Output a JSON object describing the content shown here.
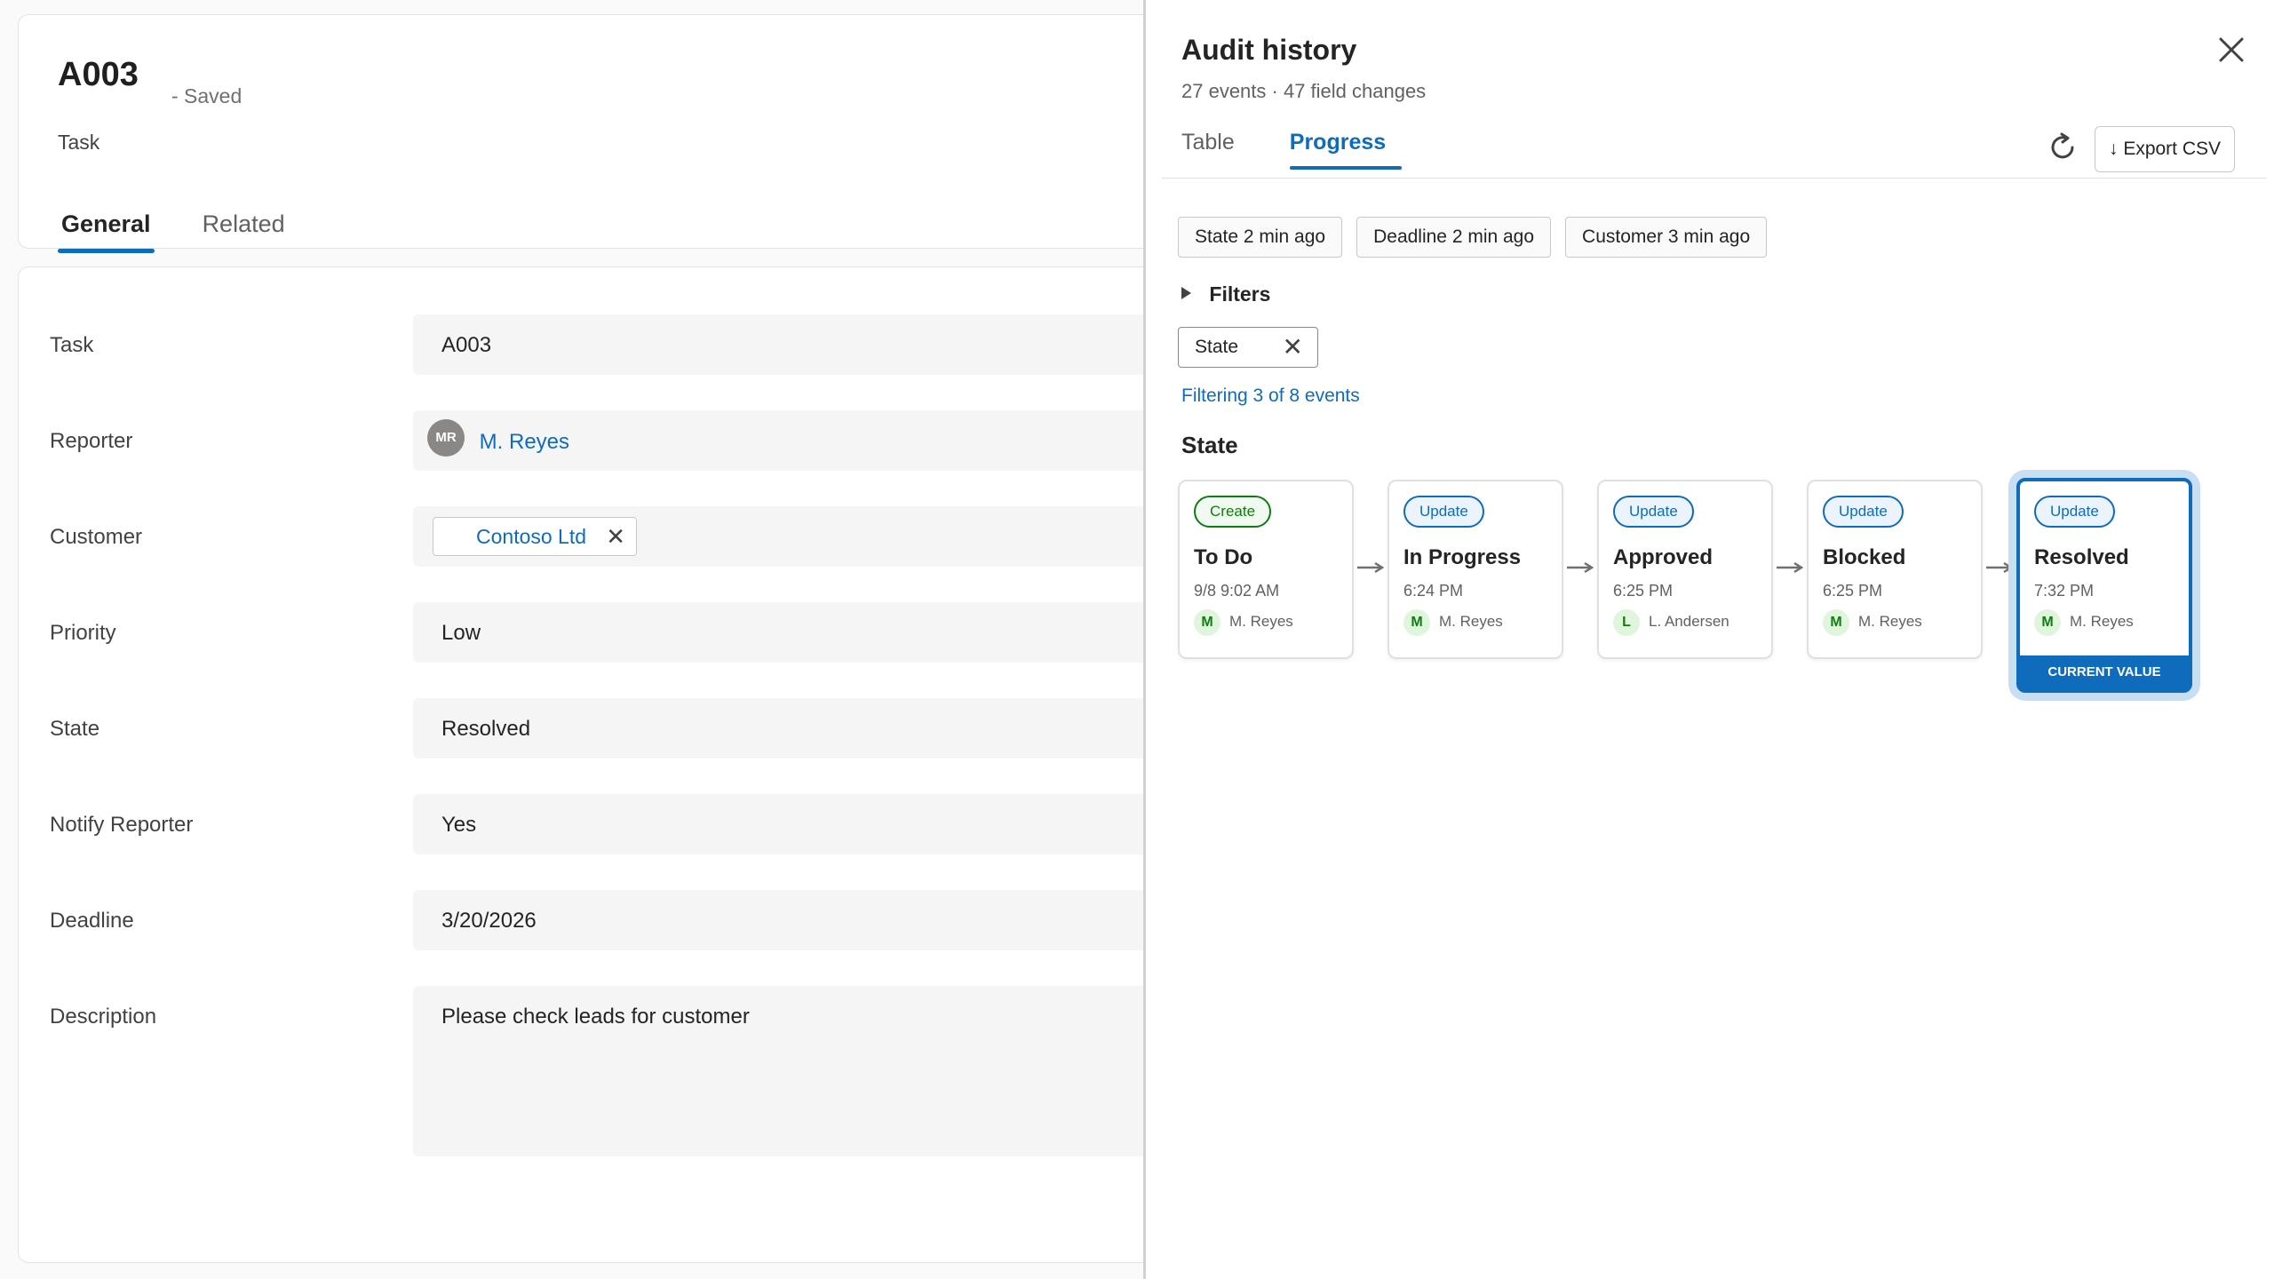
{
  "record": {
    "title": "A003",
    "saved": "- Saved",
    "type": "Task",
    "tabs": [
      "General",
      "Related"
    ]
  },
  "form": {
    "fields": [
      {
        "label": "Task",
        "value": "A003"
      },
      {
        "label": "Reporter",
        "value": "M. Reyes",
        "avatar": "MR"
      },
      {
        "label": "Customer",
        "value": "Contoso Ltd"
      },
      {
        "label": "Priority",
        "value": "Low"
      },
      {
        "label": "State",
        "value": "Resolved"
      },
      {
        "label": "Notify Reporter",
        "value": "Yes"
      },
      {
        "label": "Deadline",
        "value": "3/20/2026"
      },
      {
        "label": "Description",
        "value": "Please check leads for customer"
      }
    ]
  },
  "panel": {
    "title": "Audit history",
    "subtitle": "27 events · 47 field changes",
    "tabs": [
      "Table",
      "Progress"
    ],
    "active_tab": "Progress",
    "export_label": "Export CSV",
    "refresh_icon": "refresh-icon",
    "chips": [
      "State 2 min ago",
      "Deadline 2 min ago",
      "Customer 3 min ago"
    ],
    "filters_label": "Filters",
    "filter_pill": "State",
    "filtering_text": "Filtering 3 of 8 events",
    "section_title": "State",
    "events": [
      {
        "badge": "Create",
        "title": "To Do",
        "time": "9/8 9:02 AM",
        "initial": "M",
        "user": "M. Reyes"
      },
      {
        "badge": "Update",
        "title": "In Progress",
        "time": "6:24 PM",
        "initial": "M",
        "user": "M. Reyes"
      },
      {
        "badge": "Update",
        "title": "Approved",
        "time": "6:25 PM",
        "initial": "L",
        "user": "L. Andersen"
      },
      {
        "badge": "Update",
        "title": "Blocked",
        "time": "6:25 PM",
        "initial": "M",
        "user": "M. Reyes"
      },
      {
        "badge": "Update",
        "title": "Resolved",
        "time": "7:32 PM",
        "initial": "M",
        "user": "M. Reyes",
        "current_label": "CURRENT VALUE"
      }
    ],
    "colors": {
      "accent": "#0f6cbd",
      "create": "#107c10"
    }
  }
}
